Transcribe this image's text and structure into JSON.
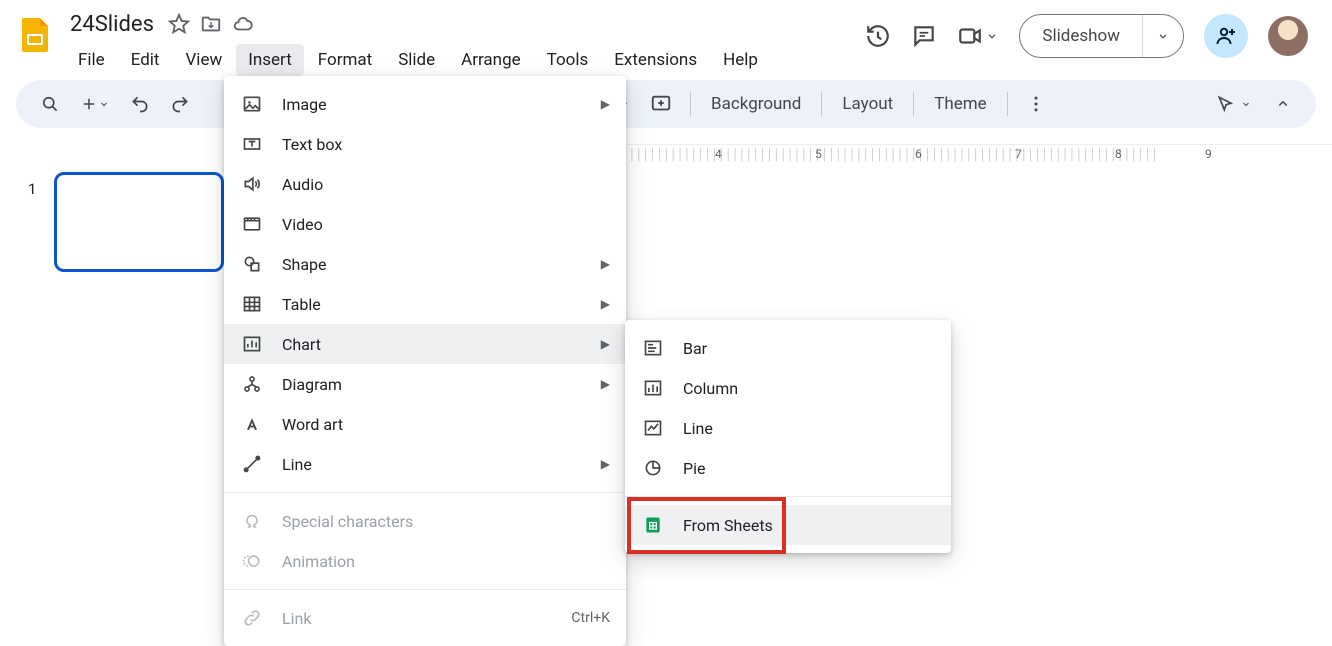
{
  "doc_title": "24Slides",
  "menubar": [
    "File",
    "Edit",
    "View",
    "Insert",
    "Format",
    "Slide",
    "Arrange",
    "Tools",
    "Extensions",
    "Help"
  ],
  "menubar_active_index": 3,
  "header_buttons": {
    "slideshow": "Slideshow"
  },
  "toolbar": {
    "background": "Background",
    "layout": "Layout",
    "theme": "Theme"
  },
  "ruler_marks": [
    4,
    5,
    6,
    7,
    8,
    9
  ],
  "filmstrip": {
    "slides": [
      {
        "number": "1"
      }
    ]
  },
  "insert_menu": {
    "items": [
      {
        "key": "image",
        "label": "Image",
        "submenu": true
      },
      {
        "key": "textbox",
        "label": "Text box"
      },
      {
        "key": "audio",
        "label": "Audio"
      },
      {
        "key": "video",
        "label": "Video"
      },
      {
        "key": "shape",
        "label": "Shape",
        "submenu": true
      },
      {
        "key": "table",
        "label": "Table",
        "submenu": true
      },
      {
        "key": "chart",
        "label": "Chart",
        "submenu": true,
        "hover": true
      },
      {
        "key": "diagram",
        "label": "Diagram",
        "submenu": true
      },
      {
        "key": "wordart",
        "label": "Word art"
      },
      {
        "key": "line",
        "label": "Line",
        "submenu": true
      }
    ],
    "group2": [
      {
        "key": "special",
        "label": "Special characters",
        "disabled": true
      },
      {
        "key": "animation",
        "label": "Animation",
        "disabled": true
      }
    ],
    "group3": [
      {
        "key": "link",
        "label": "Link",
        "disabled": true,
        "shortcut": "Ctrl+K"
      }
    ]
  },
  "chart_submenu": {
    "items": [
      {
        "key": "bar",
        "label": "Bar"
      },
      {
        "key": "column",
        "label": "Column"
      },
      {
        "key": "line",
        "label": "Line"
      },
      {
        "key": "pie",
        "label": "Pie"
      }
    ],
    "from_sheets": {
      "label": "From Sheets",
      "hover": true
    }
  }
}
